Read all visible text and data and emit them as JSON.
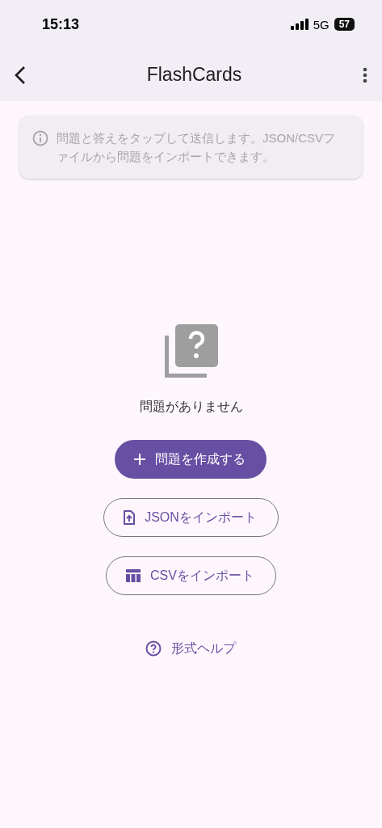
{
  "status_bar": {
    "time": "15:13",
    "network": "5G",
    "battery": "57"
  },
  "app_bar": {
    "title": "FlashCards"
  },
  "info": {
    "text": "問題と答えをタップして送信します。JSON/CSVファイルから問題をインポートできます。"
  },
  "empty_state": {
    "message": "問題がありません"
  },
  "buttons": [
    {
      "kind": "filled",
      "label": "問題を作成する"
    },
    {
      "kind": "outlined",
      "label": "JSONをインポート"
    },
    {
      "kind": "outlined",
      "label": "CSVをインポート"
    },
    {
      "kind": "text",
      "label": "形式ヘルプ"
    }
  ]
}
